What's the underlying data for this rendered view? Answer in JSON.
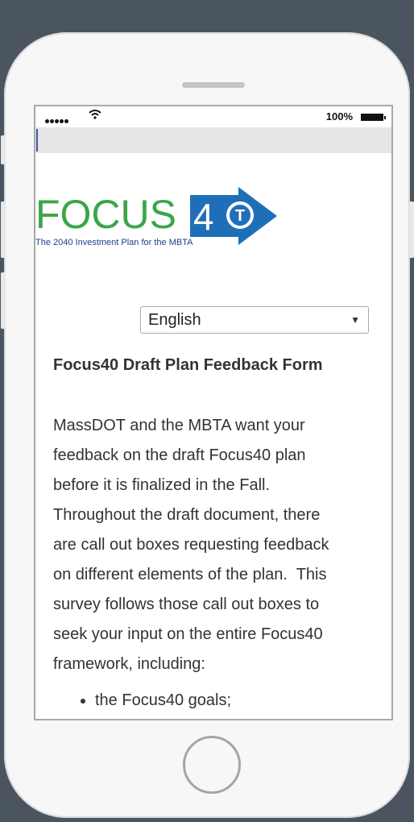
{
  "status": {
    "battery_text": "100%"
  },
  "logo": {
    "word": "FOCUS",
    "number_part": "4",
    "tagline": "The 2040 Investment Plan for the MBTA",
    "badge_letter": "T"
  },
  "language": {
    "selected": "English"
  },
  "form": {
    "title": "Focus40 Draft Plan Feedback Form",
    "intro_lines": [
      "MassDOT and the MBTA want your",
      "feedback on the draft Focus40 plan",
      "before it is finalized in the Fall.",
      "Throughout the draft document, there",
      "are call out boxes requesting feedback",
      "on different elements of the plan.  This",
      "survey follows those call out boxes to",
      "seek your input on the entire Focus40",
      "framework, including:"
    ],
    "bullets": [
      "the Focus40 goals;"
    ]
  },
  "colors": {
    "green": "#3aa64a",
    "blue": "#1f6fb8",
    "navy": "#1c3f8f"
  }
}
